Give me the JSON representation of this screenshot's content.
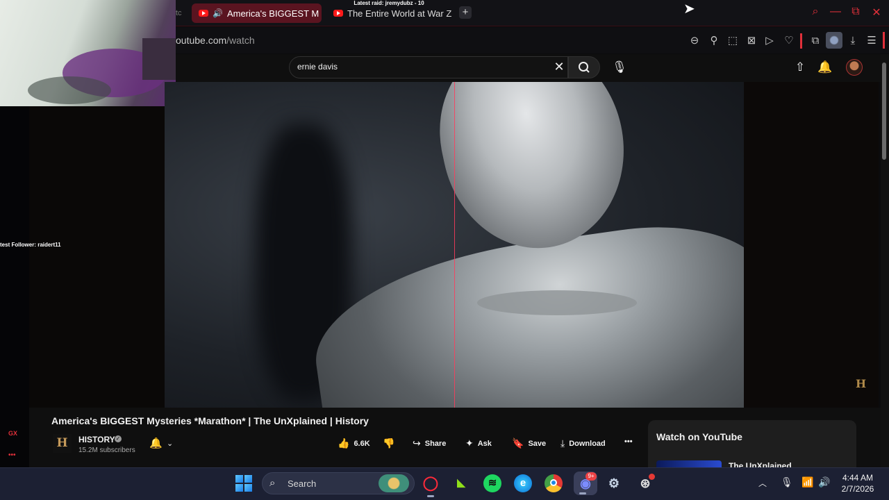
{
  "overlay": {
    "latest_raid": "Latest raid: jremydubz - 10",
    "latest_follower": "test Follower: raidert11",
    "gx_label": "GX",
    "gx_more": "•••"
  },
  "tabs": [
    {
      "label": "America's BIGGEST M",
      "active": true
    },
    {
      "label": "The Entire World at War Zo",
      "active": false
    }
  ],
  "tab_partial": "tc",
  "new_tab": "+",
  "address": {
    "host": "outube.com",
    "path": "/watch"
  },
  "youtube": {
    "search_value": "ernie davis",
    "search_clear": "✕",
    "video_title": "America's BIGGEST Mysteries *Marathon* | The UnXplained | History",
    "channel_logo": "H",
    "channel_name": "HISTORY",
    "verified_mark": "✓",
    "subscribers": "15.2M subscribers",
    "like_count": "6.6K",
    "actions": {
      "share": "Share",
      "ask": "Ask",
      "save": "Save",
      "download": "Download",
      "more": "•••"
    },
    "watermark": "H",
    "watch_panel_title": "Watch on YouTube",
    "next_video_partial": "The UnXplained"
  },
  "taskbar": {
    "search_placeholder": "Search",
    "time": "4:44 AM",
    "date": "2/7/2026",
    "discord_badge": "9+"
  },
  "icons": {
    "zoom": "zoom-out-icon",
    "pin": "pin-icon",
    "snapshot": "snapshot-icon",
    "ad_block": "ad-block-icon",
    "player": "player-icon",
    "heart": "heart-icon",
    "extensions": "extensions-icon",
    "downloads": "download-icon",
    "menu": "menu-icon"
  },
  "colors": {
    "accent": "#e0303a",
    "yt_red": "#ff1a1a",
    "taskbar": "#1c2033"
  }
}
